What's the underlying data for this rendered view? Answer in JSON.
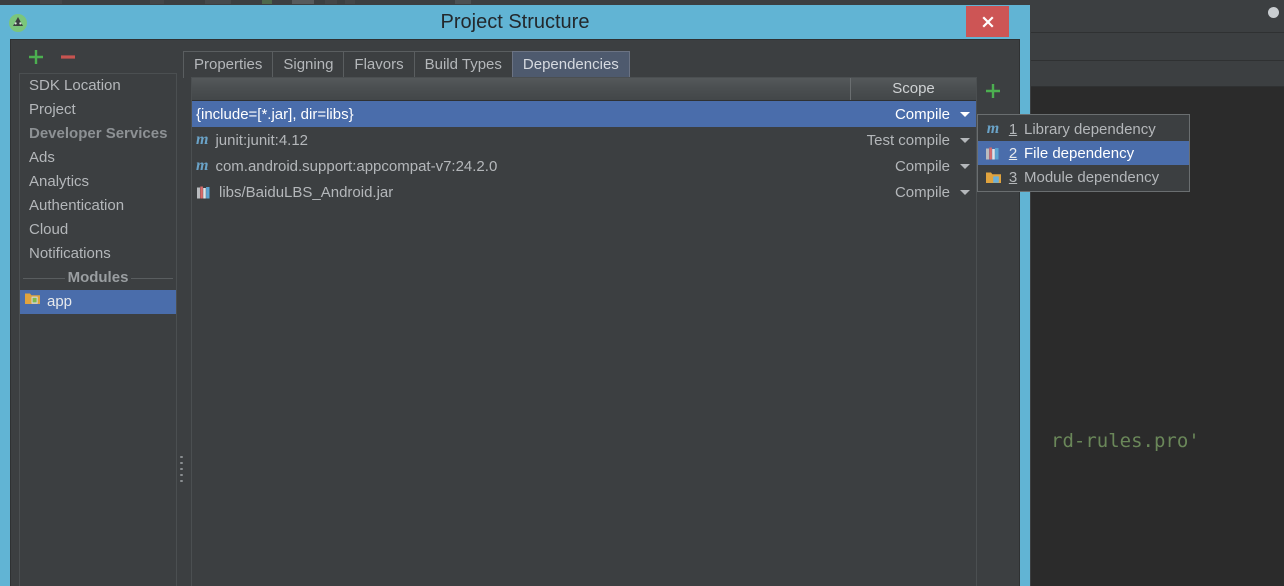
{
  "window": {
    "title": "Project Structure",
    "close_label": "×",
    "app_icon": "android-studio-icon"
  },
  "background": {
    "editor_code": "rd-rules.pro'",
    "code_color": "#6a8759",
    "editor_bg": "#2b2b2b"
  },
  "left_toolbar": {
    "add_label": "+",
    "remove_label": "−",
    "add_color": "#4caf50",
    "remove_color": "#c75450"
  },
  "sidebar": {
    "items": [
      {
        "label": "SDK Location",
        "type": "item",
        "selected": false
      },
      {
        "label": "Project",
        "type": "item",
        "selected": false
      },
      {
        "label": "Developer Services",
        "type": "header",
        "selected": false
      },
      {
        "label": "Ads",
        "type": "item",
        "selected": false
      },
      {
        "label": "Analytics",
        "type": "item",
        "selected": false
      },
      {
        "label": "Authentication",
        "type": "item",
        "selected": false
      },
      {
        "label": "Cloud",
        "type": "item",
        "selected": false
      },
      {
        "label": "Notifications",
        "type": "item",
        "selected": false
      },
      {
        "label": "Modules",
        "type": "separator",
        "selected": false
      },
      {
        "label": "app",
        "type": "module",
        "selected": true,
        "icon": "module-folder-icon"
      }
    ]
  },
  "tabs": [
    {
      "label": "Properties",
      "active": false
    },
    {
      "label": "Signing",
      "active": false
    },
    {
      "label": "Flavors",
      "active": false
    },
    {
      "label": "Build Types",
      "active": false
    },
    {
      "label": "Dependencies",
      "active": true
    }
  ],
  "table": {
    "columns": [
      "",
      "Scope"
    ],
    "rows": [
      {
        "name": "{include=[*.jar], dir=libs}",
        "scope": "Compile",
        "icon": "none",
        "selected": true
      },
      {
        "name": "junit:junit:4.12",
        "scope": "Test compile",
        "icon": "maven-icon",
        "selected": false
      },
      {
        "name": "com.android.support:appcompat-v7:24.2.0",
        "scope": "Compile",
        "icon": "maven-icon",
        "selected": false
      },
      {
        "name": "libs/BaiduLBS_Android.jar",
        "scope": "Compile",
        "icon": "library-books-icon",
        "selected": false
      }
    ]
  },
  "side_toolbar": {
    "add_label": "+",
    "add_icon": "plus-icon",
    "move_down_icon": "arrow-down-icon",
    "add_color": "#4caf50",
    "arrow_color": "#4a9fd4"
  },
  "context_menu": {
    "items": [
      {
        "mnemonic": "1",
        "label": "Library dependency",
        "icon": "maven-icon",
        "highlighted": false
      },
      {
        "mnemonic": "2",
        "label": "File dependency",
        "icon": "library-books-icon",
        "highlighted": true
      },
      {
        "mnemonic": "3",
        "label": "Module dependency",
        "icon": "module-folder-icon",
        "highlighted": false
      }
    ]
  },
  "theme": {
    "dialog_titlebar": "#61b4d4",
    "panel_bg": "#3c3f41",
    "selection_blue": "#4a6dab",
    "text": "#b4b7ba",
    "close_red": "#cd5555",
    "active_tab_bg": "#4e5a6e"
  }
}
